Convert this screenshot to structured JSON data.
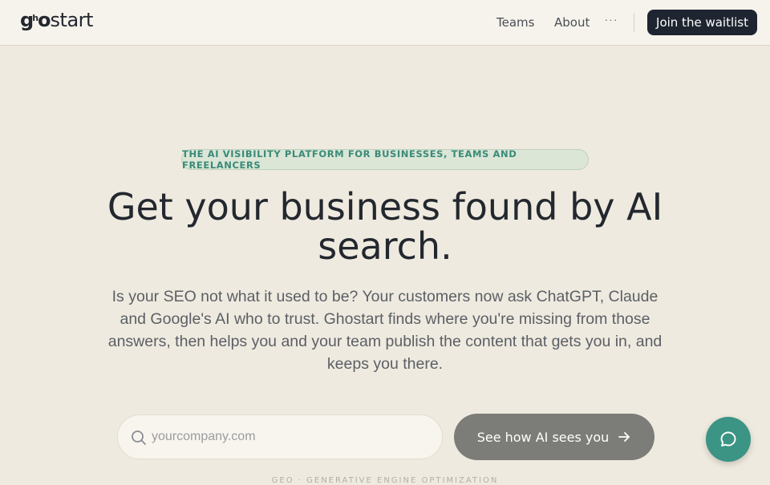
{
  "header": {
    "logo": {
      "g": "g",
      "h": "h",
      "o": "o",
      "start": "start"
    },
    "nav": {
      "teams": "Teams",
      "about": "About",
      "more": "···"
    },
    "cta_label": "Join the waitlist"
  },
  "hero": {
    "badge": "THE AI VISIBILITY PLATFORM FOR BUSINESSES, TEAMS AND FREELANCERS",
    "title": "Get your business found by AI search.",
    "subtitle": "Is your SEO not what it used to be? Your customers now ask ChatGPT, Claude and Google's AI who to trust. Ghostart finds where you're missing from those answers, then helps you and your team publish the content that gets you in, and keeps you there.",
    "search": {
      "placeholder": "yourcompany.com",
      "value": ""
    },
    "button_label": "See how AI sees you",
    "footnote": "GEO · GENERATIVE ENGINE OPTIMIZATION"
  },
  "icons": {
    "search": "search-icon",
    "arrow": "arrow-right-icon",
    "chat": "chat-bubble-icon"
  },
  "colors": {
    "background": "#efeadf",
    "header_bg": "#f6f3ec",
    "primary_dark": "#1e2530",
    "accent_teal": "#3b9484",
    "badge_bg": "#dbe6d7",
    "badge_text": "#3a8a78",
    "button_gray": "#7c7c78"
  }
}
